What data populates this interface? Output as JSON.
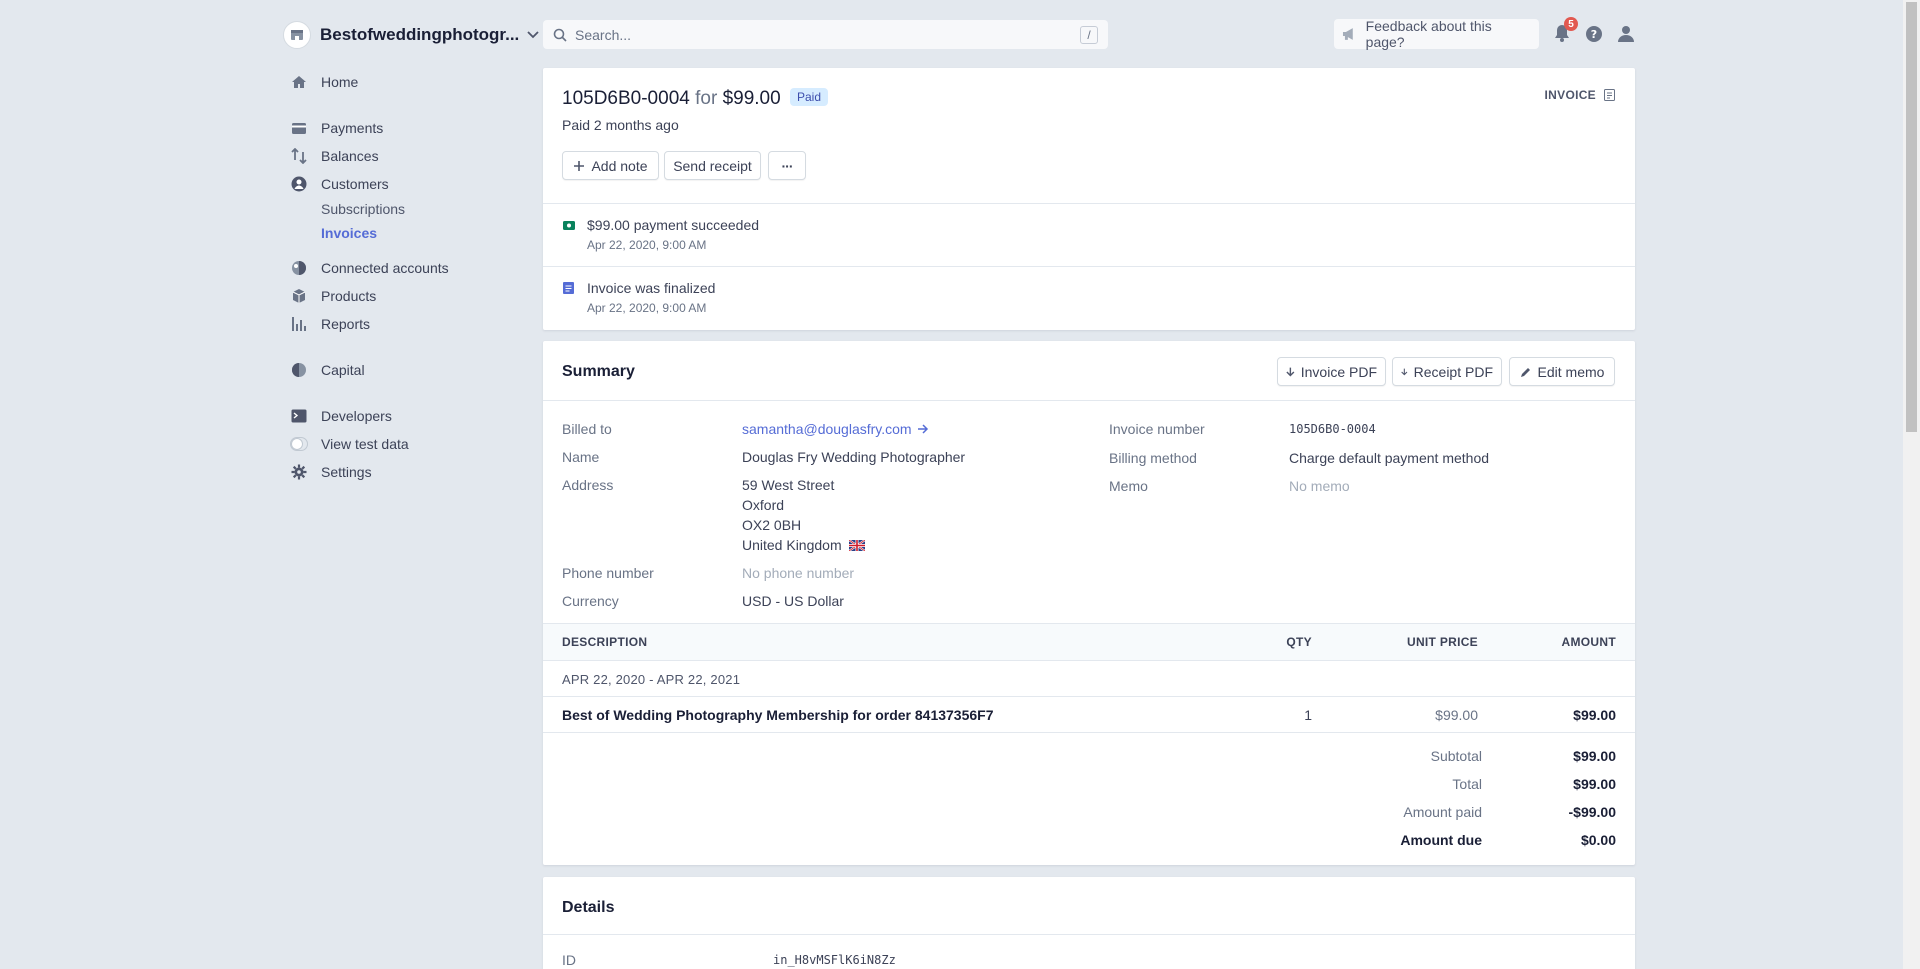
{
  "topbar": {
    "account_name": "Bestofweddingphotogr...",
    "search_placeholder": "Search...",
    "search_shortcut": "/",
    "feedback_label": "Feedback about this page?",
    "notification_count": "5"
  },
  "sidebar": {
    "home": "Home",
    "payments": "Payments",
    "balances": "Balances",
    "customers": "Customers",
    "subscriptions": "Subscriptions",
    "invoices": "Invoices",
    "connected_accounts": "Connected accounts",
    "products": "Products",
    "reports": "Reports",
    "capital": "Capital",
    "developers": "Developers",
    "view_test_data": "View test data",
    "settings": "Settings"
  },
  "invoice": {
    "number": "105D6B0-0004",
    "for_word": "for",
    "total": "$99.00",
    "status": "Paid",
    "paid_ago": "Paid 2 months ago",
    "type_label": "INVOICE",
    "add_note": "Add note",
    "send_receipt": "Send receipt",
    "more": "···"
  },
  "timeline": [
    {
      "title": "$99.00 payment succeeded",
      "time": "Apr 22, 2020, 9:00 AM"
    },
    {
      "title": "Invoice was finalized",
      "time": "Apr 22, 2020, 9:00 AM"
    }
  ],
  "summary": {
    "heading": "Summary",
    "invoice_pdf": "Invoice PDF",
    "receipt_pdf": "Receipt PDF",
    "edit_memo": "Edit memo",
    "billed_to_label": "Billed to",
    "billed_to": "samantha@douglasfry.com",
    "name_label": "Name",
    "name": "Douglas Fry Wedding Photographer",
    "address_label": "Address",
    "address": [
      "59 West Street",
      "Oxford",
      "OX2 0BH",
      "United Kingdom"
    ],
    "phone_label": "Phone number",
    "phone": "No phone number",
    "currency_label": "Currency",
    "currency": "USD - US Dollar",
    "invoice_number_label": "Invoice number",
    "invoice_number": "105D6B0-0004",
    "billing_method_label": "Billing method",
    "billing_method": "Charge default payment method",
    "memo_label": "Memo",
    "memo": "No memo"
  },
  "line_items": {
    "headers": {
      "description": "DESCRIPTION",
      "qty": "QTY",
      "unit_price": "UNIT PRICE",
      "amount": "AMOUNT"
    },
    "period": "APR 22, 2020 - APR 22, 2021",
    "rows": [
      {
        "description": "Best of Wedding Photography Membership for order 84137356F7",
        "qty": "1",
        "unit_price": "$99.00",
        "amount": "$99.00"
      }
    ],
    "totals": {
      "subtotal_label": "Subtotal",
      "subtotal": "$99.00",
      "total_label": "Total",
      "total": "$99.00",
      "amount_paid_label": "Amount paid",
      "amount_paid": "-$99.00",
      "amount_due_label": "Amount due",
      "amount_due": "$0.00"
    }
  },
  "details": {
    "heading": "Details",
    "id_label": "ID",
    "id": "in_H8vMSFlK6iN8Zz"
  },
  "colors": {
    "accent": "#556cd6",
    "paid_badge_bg": "#d6ecff",
    "paid_badge_text": "#3d4eac",
    "success_green": "#09825d",
    "notification_red": "#e25950"
  }
}
